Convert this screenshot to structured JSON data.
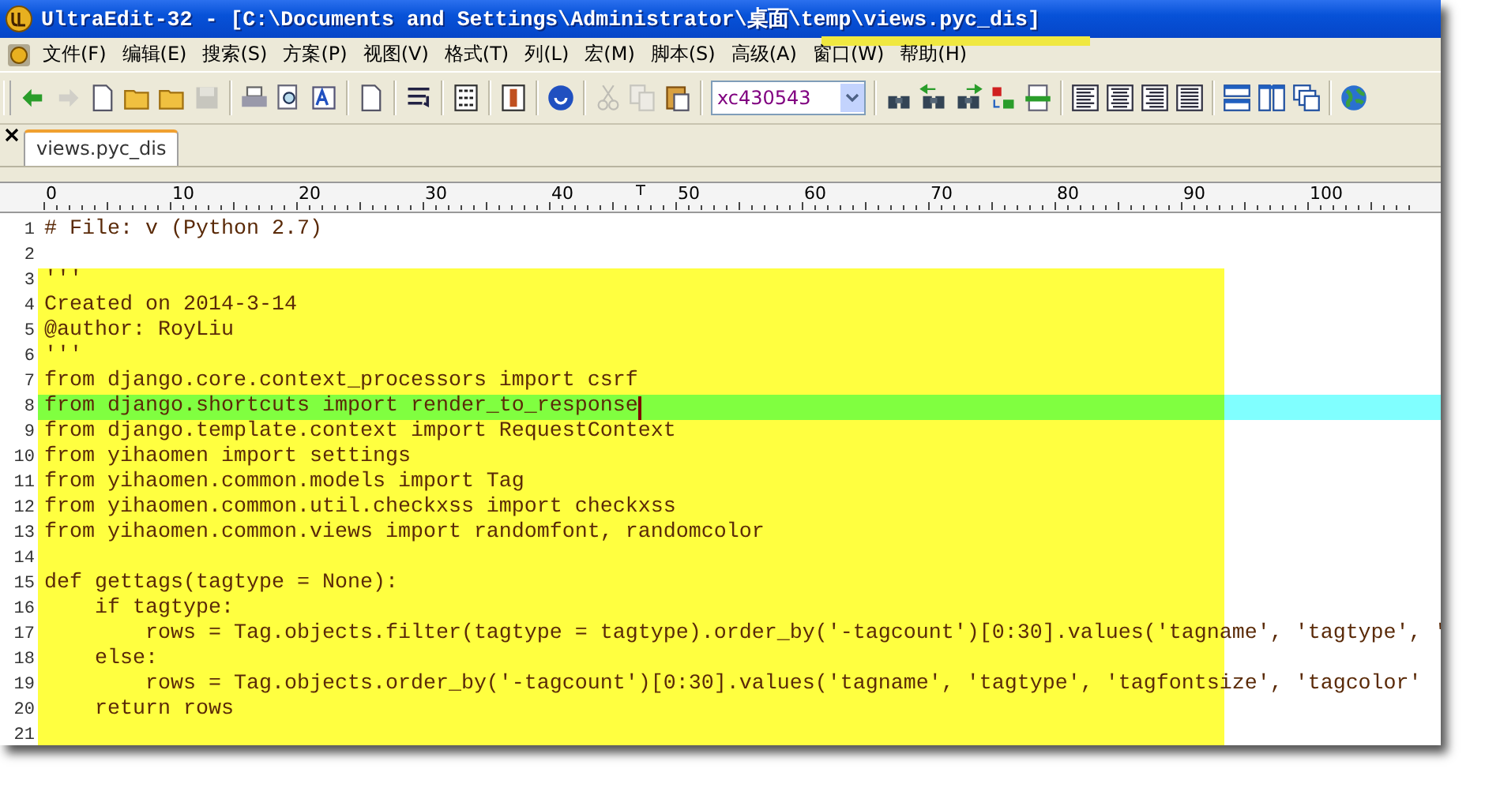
{
  "window": {
    "title": "UltraEdit-32 - [C:\\Documents and Settings\\Administrator\\桌面\\temp\\views.pyc_dis]"
  },
  "menu": [
    "文件(F)",
    "编辑(E)",
    "搜索(S)",
    "方案(P)",
    "视图(V)",
    "格式(T)",
    "列(L)",
    "宏(M)",
    "脚本(S)",
    "高级(A)",
    "窗口(W)",
    "帮助(H)"
  ],
  "toolbar": [
    {
      "kind": "back",
      "disabled": false
    },
    {
      "kind": "forward",
      "disabled": true
    },
    {
      "kind": "new",
      "disabled": false
    },
    {
      "kind": "open",
      "disabled": false
    },
    {
      "kind": "open",
      "disabled": false
    },
    {
      "kind": "save",
      "disabled": true
    },
    {
      "kind": "separator"
    },
    {
      "kind": "print",
      "disabled": false
    },
    {
      "kind": "preview",
      "disabled": false
    },
    {
      "kind": "font",
      "disabled": false
    },
    {
      "kind": "separator"
    },
    {
      "kind": "document",
      "disabled": false
    },
    {
      "kind": "separator"
    },
    {
      "kind": "wrap",
      "disabled": false
    },
    {
      "kind": "separator"
    },
    {
      "kind": "hex",
      "disabled": false
    },
    {
      "kind": "separator"
    },
    {
      "kind": "column",
      "disabled": false
    },
    {
      "kind": "separator"
    },
    {
      "kind": "web",
      "disabled": false
    },
    {
      "kind": "separator"
    },
    {
      "kind": "cut",
      "disabled": true
    },
    {
      "kind": "copy",
      "disabled": true
    },
    {
      "kind": "paste",
      "disabled": false
    },
    {
      "kind": "separator"
    },
    {
      "kind": "combo",
      "value": "xc430543"
    },
    {
      "kind": "separator"
    },
    {
      "kind": "find",
      "disabled": false
    },
    {
      "kind": "find-prev",
      "disabled": false
    },
    {
      "kind": "find-next",
      "disabled": false
    },
    {
      "kind": "replace",
      "disabled": false
    },
    {
      "kind": "goto",
      "disabled": false
    },
    {
      "kind": "separator"
    },
    {
      "kind": "align-left",
      "disabled": false
    },
    {
      "kind": "align-center",
      "disabled": false
    },
    {
      "kind": "align-right",
      "disabled": false
    },
    {
      "kind": "justify",
      "disabled": false
    },
    {
      "kind": "separator"
    },
    {
      "kind": "split-h",
      "disabled": false
    },
    {
      "kind": "split-v",
      "disabled": false
    },
    {
      "kind": "cascade",
      "disabled": false
    },
    {
      "kind": "separator"
    },
    {
      "kind": "globe",
      "disabled": false
    }
  ],
  "tabs": [
    {
      "label": "views.pyc_dis",
      "selected": true
    }
  ],
  "ruler": [
    "0",
    "10",
    "20",
    "30",
    "40",
    "50",
    "60",
    "70",
    "80",
    "90",
    "100"
  ],
  "lines": [
    {
      "number": "1",
      "text": "# File: v (Python 2.7)",
      "kind": "plain"
    },
    {
      "number": "2",
      "kind": "plain"
    },
    {
      "number": "3",
      "text": "'''",
      "kind": "block"
    },
    {
      "number": "4",
      "text": "Created on 2014-3-14",
      "kind": "block"
    },
    {
      "number": "5",
      "text": "@author: RoyLiu",
      "kind": "block"
    },
    {
      "number": "6",
      "text": "'''",
      "kind": "block"
    },
    {
      "number": "7",
      "text": "from django.core.context_processors import csrf",
      "kind": "block"
    },
    {
      "number": "8",
      "text": "from django.shortcuts import render_to_response",
      "kind": "current"
    },
    {
      "number": "9",
      "text": "from django.template.context import RequestContext",
      "kind": "block"
    },
    {
      "number": "10",
      "text": "from yihaomen import settings",
      "kind": "block"
    },
    {
      "number": "11",
      "text": "from yihaomen.common.models import Tag",
      "kind": "block"
    },
    {
      "number": "12",
      "text": "from yihaomen.common.util.checkxss import checkxss",
      "kind": "block"
    },
    {
      "number": "13",
      "text": "from yihaomen.common.views import randomfont, randomcolor",
      "kind": "block"
    },
    {
      "number": "14",
      "kind": "block"
    },
    {
      "number": "15",
      "text": "def gettags(tagtype = None):",
      "kind": "block"
    },
    {
      "number": "16",
      "text": "    if tagtype:",
      "kind": "block"
    },
    {
      "number": "17",
      "text": "        rows = Tag.objects.filter(tagtype = tagtype).order_by('-tagcount')[0:30].values('tagname', 'tagtype', '",
      "kind": "block"
    },
    {
      "number": "18",
      "text": "    else:",
      "kind": "block"
    },
    {
      "number": "19",
      "text": "        rows = Tag.objects.order_by('-tagcount')[0:30].values('tagname', 'tagtype', 'tagfontsize', 'tagcolor'",
      "kind": "block"
    },
    {
      "number": "20",
      "text": "    return rows",
      "kind": "block"
    },
    {
      "number": "21",
      "kind": "block"
    }
  ]
}
